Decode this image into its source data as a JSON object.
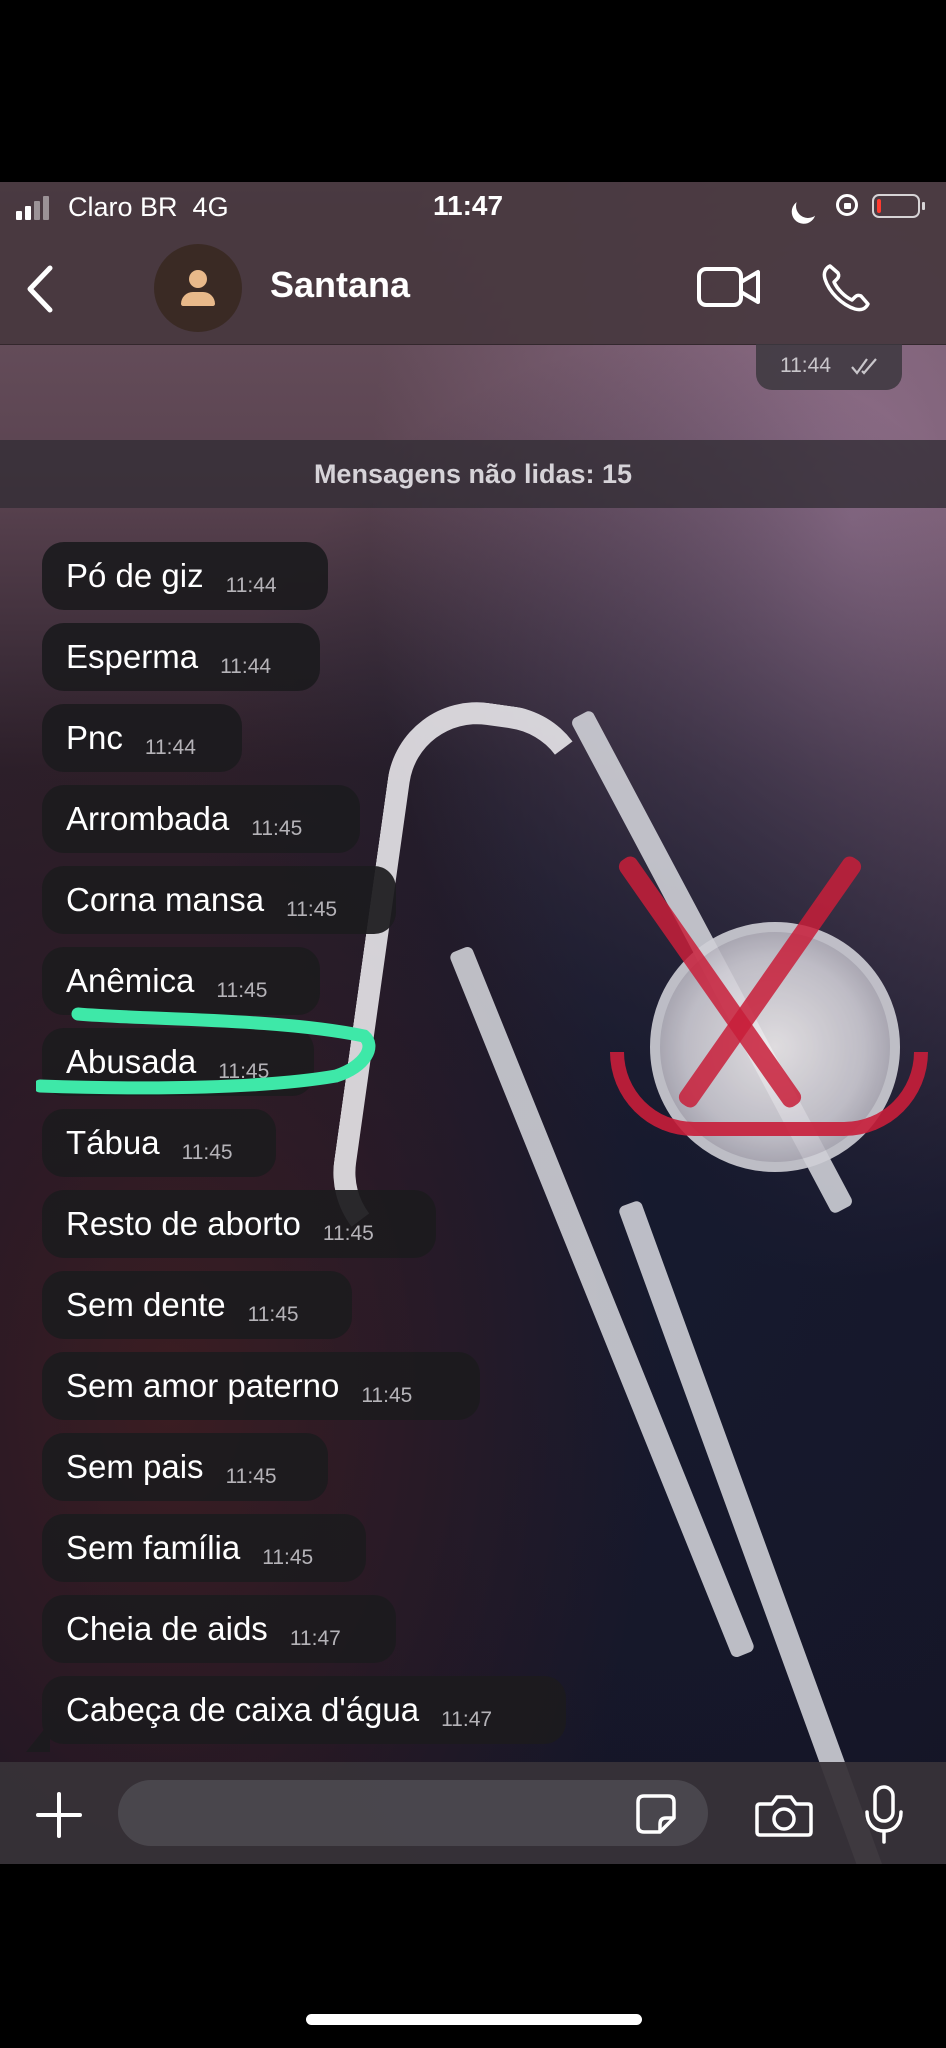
{
  "status_bar": {
    "carrier": "Claro BR",
    "network": "4G",
    "time": "11:47",
    "battery_level": 0.1
  },
  "header": {
    "contact_name": "Santana"
  },
  "previous_message": {
    "time": "11:44"
  },
  "unread_banner": "Mensagens não lidas: 15",
  "messages": [
    {
      "text": "Pó de giz",
      "time": "11:44"
    },
    {
      "text": "Esperma",
      "time": "11:44"
    },
    {
      "text": "Pnc",
      "time": "11:44"
    },
    {
      "text": "Arrombada",
      "time": "11:45"
    },
    {
      "text": "Corna mansa",
      "time": "11:45"
    },
    {
      "text": "Anêmica",
      "time": "11:45"
    },
    {
      "text": "Abusada",
      "time": "11:45"
    },
    {
      "text": "Tábua",
      "time": "11:45"
    },
    {
      "text": "Resto de aborto",
      "time": "11:45"
    },
    {
      "text": "Sem dente",
      "time": "11:45"
    },
    {
      "text": "Sem amor paterno",
      "time": "11:45"
    },
    {
      "text": "Sem pais",
      "time": "11:45"
    },
    {
      "text": "Sem família",
      "time": "11:45"
    },
    {
      "text": "Cheia de aids",
      "time": "11:47"
    },
    {
      "text": "Cabeça de caixa d'água",
      "time": "11:47"
    }
  ],
  "input": {
    "placeholder": "",
    "value": ""
  },
  "icons": {
    "back": "chevron-left-icon",
    "video": "video-camera-icon",
    "call": "phone-icon",
    "attach": "plus-icon",
    "sticker": "sticker-icon",
    "camera": "camera-icon",
    "mic": "microphone-icon"
  },
  "colors": {
    "highlight": "#3ee8a8",
    "battery_low": "#ff3b30",
    "bubble": "#1c1b1e"
  }
}
